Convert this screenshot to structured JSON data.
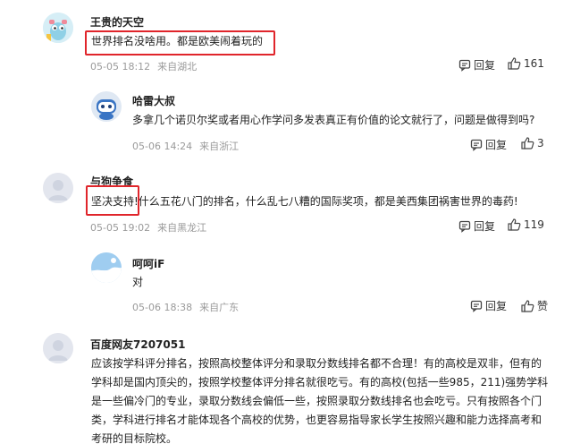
{
  "comments": [
    {
      "username": "王贵的天空",
      "text": "世界排名没啥用。都是欧美闹着玩的",
      "date": "05-05 18:12",
      "location": "来自湖北",
      "reply_label": "回复",
      "likes": "161"
    },
    {
      "username": "哈雷大叔",
      "text": "多拿几个诺贝尔奖或者用心作学问多发表真正有价值的论文就行了，问题是做得到吗?",
      "date": "05-06 14:24",
      "location": "来自浙江",
      "reply_label": "回复",
      "likes": "3"
    },
    {
      "username": "与狗争食",
      "text": "坚决支持!什么五花八门的排名，什么乱七八糟的国际奖项，都是美西集团祸害世界的毒药!",
      "date": "05-05 19:02",
      "location": "来自黑龙江",
      "reply_label": "回复",
      "likes": "119"
    },
    {
      "username": "呵呵iF",
      "text": "对",
      "date": "05-06 18:38",
      "location": "来自广东",
      "reply_label": "回复",
      "likes": "赞"
    },
    {
      "username": "百度网友7207051",
      "text": "应该按学科评分排名，按照高校整体评分和录取分数线排名都不合理！有的高校是双非，但有的学科却是国内顶尖的，按照学校整体评分排名就很吃亏。有的高校(包括一些985，211)强势学科是一些偏冷门的专业，录取分数线会偏低一些，按照录取分数线排名也会吃亏。只有按照各个门类，学科进行排名才能体现各个高校的优势，也更容易指导家长学生按照兴趣和能力选择高考和考研的目标院校。"
    }
  ],
  "colors": {
    "highlight": "#e0252b",
    "meta_gray": "#9a9a9a"
  },
  "icons": {
    "reply": "comment-bubble-icon",
    "like": "thumbs-up-icon"
  }
}
